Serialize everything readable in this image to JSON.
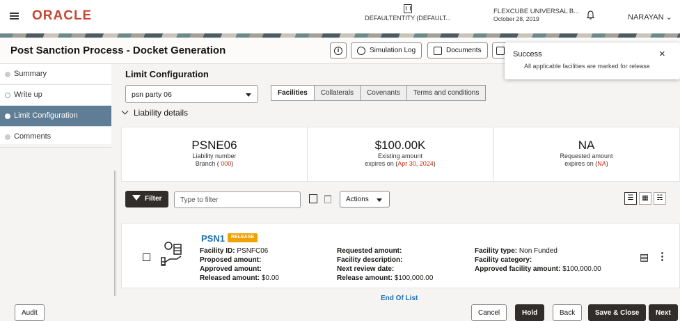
{
  "header": {
    "logo": "ORACLE",
    "entity": "DEFAULTENTITY (DEFAULT...",
    "app_name": "FLEXCUBE UNIVERSAL B...",
    "app_date": "October 28, 2019",
    "user": "NARAYAN"
  },
  "page": {
    "title": "Post Sanction Process - Docket Generation",
    "toolbar": {
      "info": "i",
      "simulation_log": "Simulation Log",
      "documents": "Documents"
    }
  },
  "toast": {
    "title": "Success",
    "message": "All applicable facilities are marked for release",
    "close": "×"
  },
  "sidebar": {
    "items": [
      {
        "label": "Summary",
        "state": "pending"
      },
      {
        "label": "Write up",
        "state": "done"
      },
      {
        "label": "Limit Configuration",
        "state": "active"
      },
      {
        "label": "Comments",
        "state": "pending"
      }
    ]
  },
  "limit": {
    "title": "Limit Configuration",
    "party": "psn party 06",
    "tabs": [
      "Facilities",
      "Collaterals",
      "Covenants",
      "Terms and conditions"
    ],
    "section": "Liability details"
  },
  "cards": [
    {
      "big": "PSNE06",
      "l1": "Liability number",
      "l2a": "Branch ( ",
      "l2b": "000",
      "l2c": ")"
    },
    {
      "big": "$100.00K",
      "l1": "Existing amount",
      "l2a": "expires on (",
      "l2b": "Apr 30, 2024",
      "l2c": ")"
    },
    {
      "big": "NA",
      "l1": "Requested amount",
      "l2a": "expires on (",
      "l2b": "NA",
      "l2c": ")"
    }
  ],
  "filterbar": {
    "filter": "Filter",
    "placeholder": "Type to filter",
    "actions": "Actions"
  },
  "record": {
    "name": "PSN1",
    "badge": "RELEASE",
    "col1": [
      {
        "k": "Facility ID:",
        "v": " PSNFC06"
      },
      {
        "k": "Proposed amount:",
        "v": ""
      },
      {
        "k": "Approved amount:",
        "v": ""
      },
      {
        "k": "Released amount:",
        "v": " $0.00"
      }
    ],
    "col2": [
      {
        "k": "Requested amount:",
        "v": ""
      },
      {
        "k": "Facility description:",
        "v": ""
      },
      {
        "k": "Next review date:",
        "v": ""
      },
      {
        "k": "Release amount:",
        "v": " $100,000.00"
      }
    ],
    "col3": [
      {
        "k": "Facility type:",
        "v": " Non Funded"
      },
      {
        "k": "Facility category:",
        "v": ""
      },
      {
        "k": "Approved facility amount:",
        "v": " $100,000.00"
      }
    ]
  },
  "end_of_list": "End Of List",
  "footer": {
    "audit": "Audit",
    "cancel": "Cancel",
    "hold": "Hold",
    "back": "Back",
    "save_close": "Save & Close",
    "next": "Next"
  }
}
